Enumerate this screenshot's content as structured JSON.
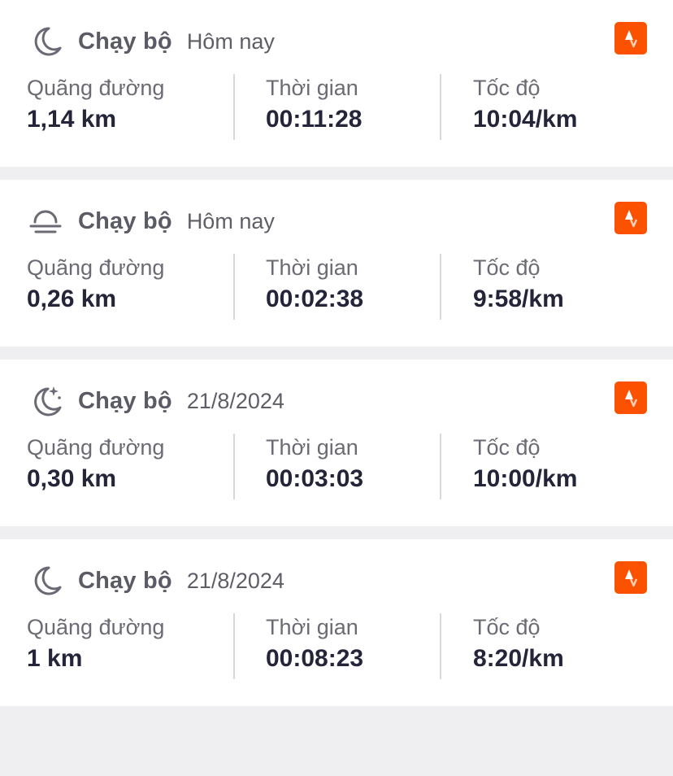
{
  "activities": [
    {
      "time_icon": "moon-icon",
      "type": "Chạy bộ",
      "date": "Hôm nay",
      "source_icon": "strava-icon",
      "metrics": [
        {
          "label": "Quãng đường",
          "value": "1,14 km"
        },
        {
          "label": "Thời gian",
          "value": "00:11:28"
        },
        {
          "label": "Tốc độ",
          "value": "10:04/km"
        }
      ]
    },
    {
      "time_icon": "sunset-icon",
      "type": "Chạy bộ",
      "date": "Hôm nay",
      "source_icon": "strava-icon",
      "metrics": [
        {
          "label": "Quãng đường",
          "value": "0,26 km"
        },
        {
          "label": "Thời gian",
          "value": "00:02:38"
        },
        {
          "label": "Tốc độ",
          "value": "9:58/km"
        }
      ]
    },
    {
      "time_icon": "moon-stars-icon",
      "type": "Chạy bộ",
      "date": "21/8/2024",
      "source_icon": "strava-icon",
      "metrics": [
        {
          "label": "Quãng đường",
          "value": "0,30 km"
        },
        {
          "label": "Thời gian",
          "value": "00:03:03"
        },
        {
          "label": "Tốc độ",
          "value": "10:00/km"
        }
      ]
    },
    {
      "time_icon": "moon-icon",
      "type": "Chạy bộ",
      "date": "21/8/2024",
      "source_icon": "strava-icon",
      "metrics": [
        {
          "label": "Quãng đường",
          "value": "1 km"
        },
        {
          "label": "Thời gian",
          "value": "00:08:23"
        },
        {
          "label": "Tốc độ",
          "value": "8:20/km"
        }
      ]
    }
  ],
  "colors": {
    "strava_brand": "#fc5200",
    "background": "#efeff1",
    "value_text": "#25253a",
    "label_text": "#6b6b75"
  }
}
